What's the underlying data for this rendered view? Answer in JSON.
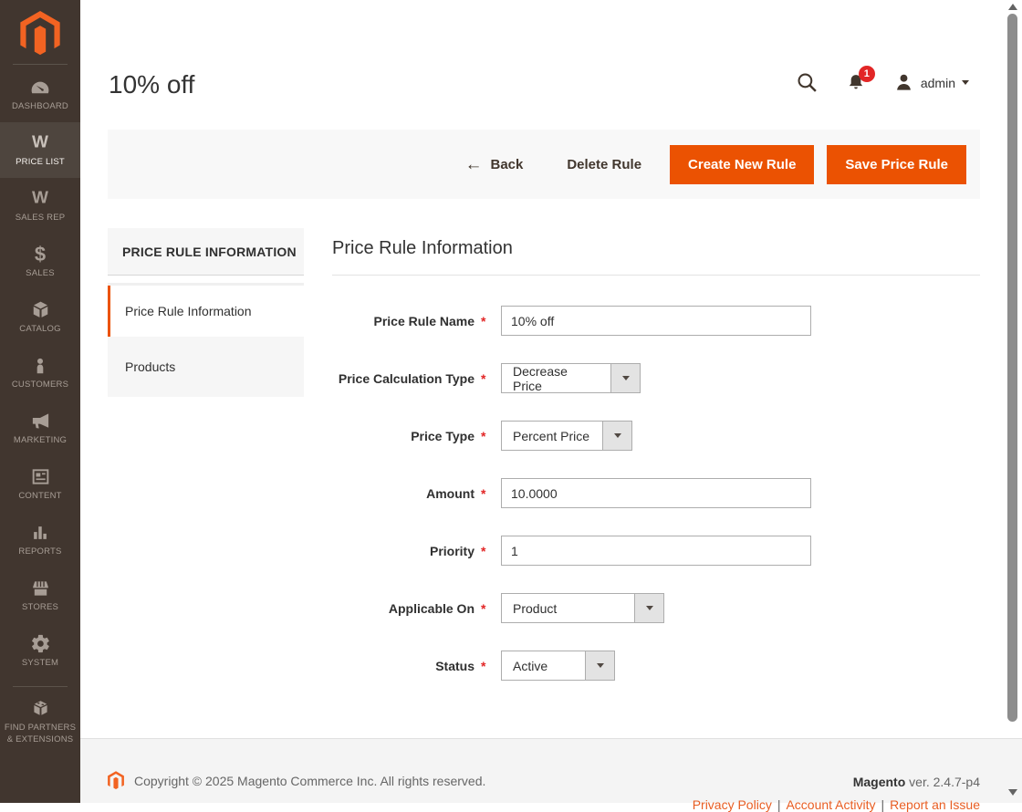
{
  "colors": {
    "accent": "#eb5202",
    "sidebar_bg": "#41362f",
    "sidebar_active_bg": "#4e453e",
    "logo_orange": "#f26322",
    "badge_red": "#e22626",
    "required_red": "#e22626",
    "bar_bg": "#f8f8f8",
    "footer_bg": "#f4f4f4"
  },
  "sidebar": {
    "items": [
      {
        "label": "DASHBOARD",
        "icon": "dashboard-icon",
        "active": false
      },
      {
        "label": "PRICE LIST",
        "icon": "price-list-icon",
        "active": true
      },
      {
        "label": "SALES REP",
        "icon": "sales-rep-icon",
        "active": false
      },
      {
        "label": "SALES",
        "icon": "sales-icon",
        "active": false
      },
      {
        "label": "CATALOG",
        "icon": "catalog-icon",
        "active": false
      },
      {
        "label": "CUSTOMERS",
        "icon": "customers-icon",
        "active": false
      },
      {
        "label": "MARKETING",
        "icon": "marketing-icon",
        "active": false
      },
      {
        "label": "CONTENT",
        "icon": "content-icon",
        "active": false
      },
      {
        "label": "REPORTS",
        "icon": "reports-icon",
        "active": false
      },
      {
        "label": "STORES",
        "icon": "stores-icon",
        "active": false
      },
      {
        "label": "SYSTEM",
        "icon": "system-icon",
        "active": false
      },
      {
        "label": "FIND PARTNERS & EXTENSIONS",
        "icon": "find-partners-icon",
        "active": false
      }
    ]
  },
  "header": {
    "title": "10% off",
    "notification_count": "1",
    "user": "admin"
  },
  "actions": {
    "back_arrow": "←",
    "back": "Back",
    "delete": "Delete Rule",
    "create": "Create New Rule",
    "save": "Save Price Rule"
  },
  "tabs": {
    "header": "PRICE RULE INFORMATION",
    "items": [
      {
        "label": "Price Rule Information",
        "active": true
      },
      {
        "label": "Products",
        "active": false
      }
    ]
  },
  "form": {
    "title": "Price Rule Information",
    "required_mark": "*",
    "fields": [
      {
        "label": "Price Rule Name",
        "type": "text",
        "value": "10% off",
        "required": true
      },
      {
        "label": "Price Calculation Type",
        "type": "select",
        "value": "Decrease Price",
        "required": true
      },
      {
        "label": "Price Type",
        "type": "select",
        "value": "Percent Price",
        "required": true
      },
      {
        "label": "Amount",
        "type": "text",
        "value": "10.0000",
        "required": true
      },
      {
        "label": "Priority",
        "type": "text",
        "value": "1",
        "required": true
      },
      {
        "label": "Applicable On",
        "type": "select",
        "value": "Product",
        "required": true
      },
      {
        "label": "Status",
        "type": "select",
        "value": "Active",
        "required": true
      }
    ]
  },
  "footer": {
    "copyright": "Copyright © 2025 Magento Commerce Inc. All rights reserved.",
    "brand": "Magento",
    "version": " ver. 2.4.7-p4",
    "separator": "|",
    "links": [
      "Privacy Policy",
      "Account Activity",
      "Report an Issue"
    ]
  }
}
